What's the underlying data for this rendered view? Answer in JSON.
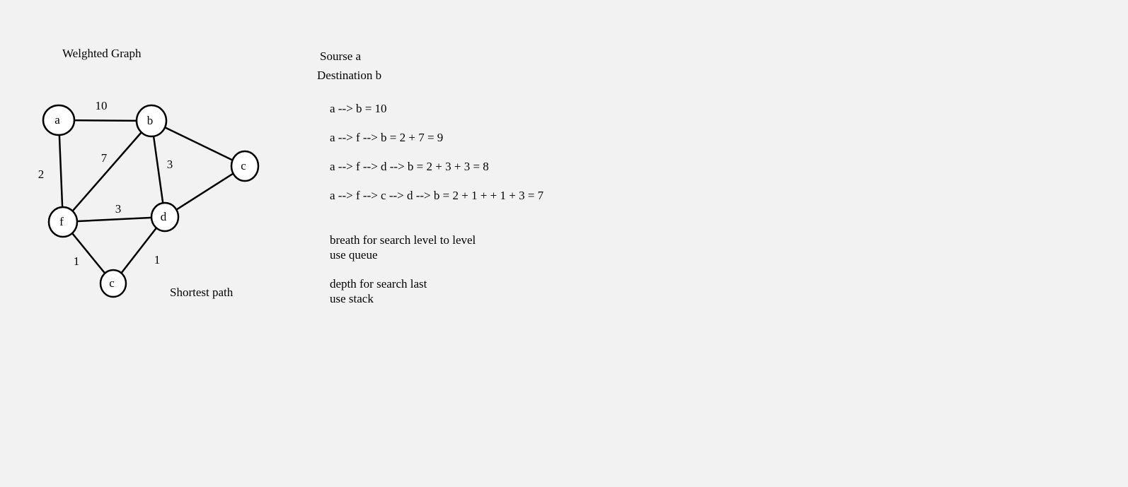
{
  "title": "Welghted Graph",
  "caption": "Shortest path",
  "source": "Sourse a",
  "destination": "Destination b",
  "paths": [
    "a --> b = 10",
    "a --> f --> b = 2 + 7 = 9",
    "a --> f --> d --> b = 2 + 3 + 3 = 8",
    "a --> f --> c --> d --> b = 2 + 1 + + 1 + 3 = 7"
  ],
  "notes": [
    "breath for search level to level",
    "use queue",
    "depth for search last",
    "use stack"
  ],
  "graph": {
    "nodes": [
      {
        "id": "a",
        "label": "a"
      },
      {
        "id": "b",
        "label": "b"
      },
      {
        "id": "c_right",
        "label": "c"
      },
      {
        "id": "d",
        "label": "d"
      },
      {
        "id": "f",
        "label": "f"
      },
      {
        "id": "c_bottom",
        "label": "c"
      }
    ],
    "edges": [
      {
        "from": "a",
        "to": "b",
        "weight": "10"
      },
      {
        "from": "a",
        "to": "f",
        "weight": "2"
      },
      {
        "from": "f",
        "to": "b",
        "weight": "7"
      },
      {
        "from": "b",
        "to": "d",
        "weight": "3"
      },
      {
        "from": "b",
        "to": "c_right",
        "weight": ""
      },
      {
        "from": "c_right",
        "to": "d",
        "weight": ""
      },
      {
        "from": "f",
        "to": "d",
        "weight": "3"
      },
      {
        "from": "f",
        "to": "c_bottom",
        "weight": "1"
      },
      {
        "from": "c_bottom",
        "to": "d",
        "weight": "1"
      }
    ]
  }
}
